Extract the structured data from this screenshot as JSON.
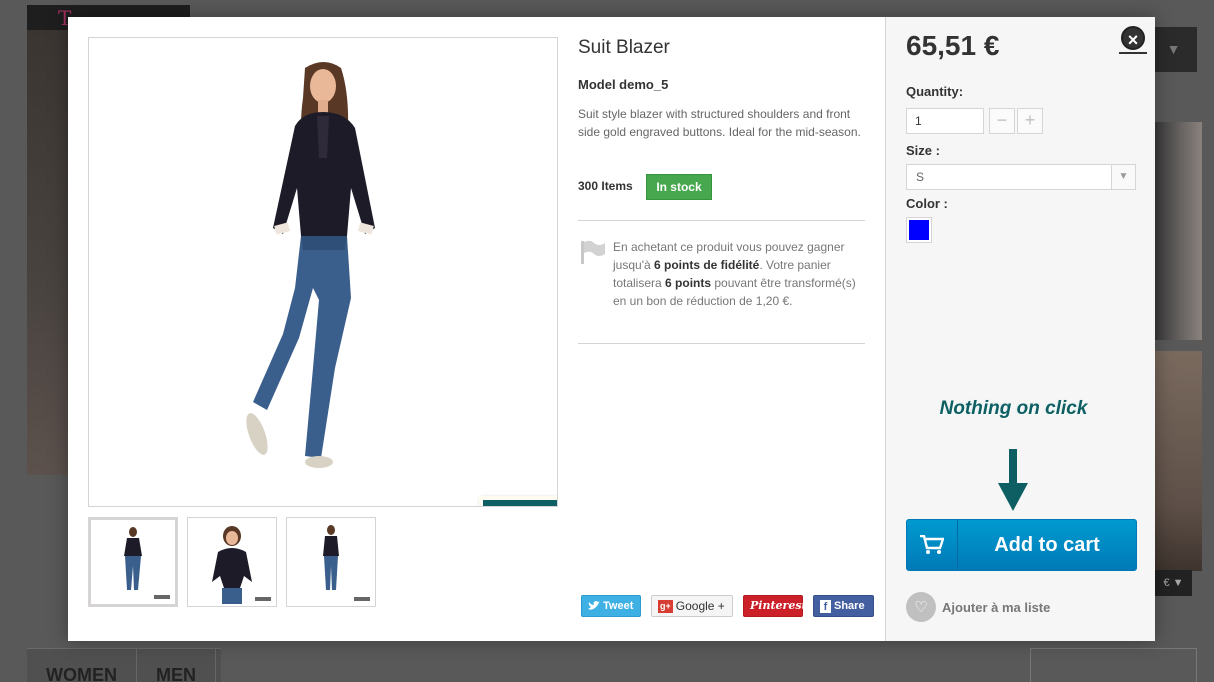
{
  "background": {
    "logo_text": "T",
    "nav": [
      "WOMEN",
      "MEN"
    ],
    "dropdown_icon": "chevron-down-icon",
    "price_tag": "€ ▼"
  },
  "product": {
    "name": "Suit Blazer",
    "model": "Model demo_5",
    "description": "Suit style blazer with structured shoulders and front side gold engraved buttons. Ideal for the mid-season.",
    "quantity_text": "300 Items",
    "stock": "In stock",
    "loyalty": {
      "part1": "En achetant ce produit vous pouvez gagner jusqu'à ",
      "bold1": "6 points de fidélité",
      "part2": ". Votre panier totalisera ",
      "bold2": "6 points",
      "part3": " pouvant être transformé(s) en un bon de réduction de 1,20 €."
    }
  },
  "social": {
    "tweet": "Tweet",
    "google": "Google +",
    "google_badge": "g+",
    "pinterest": "Pinterest",
    "facebook": "Share",
    "facebook_badge": "f"
  },
  "buy_box": {
    "price": "65,51 €",
    "quantity_label": "Quantity:",
    "quantity_value": "1",
    "minus": "−",
    "plus": "+",
    "size_label": "Size :",
    "size_value": "S",
    "color_label": "Color :",
    "color_value": "#0000ff",
    "annotation": "Nothing on click",
    "add_to_cart": "Add to cart",
    "wishlist": "Ajouter à ma liste"
  },
  "colors": {
    "accent_blue": "#009ad0",
    "stock_green": "#46a74e",
    "annotation_teal": "#0d5f63"
  }
}
